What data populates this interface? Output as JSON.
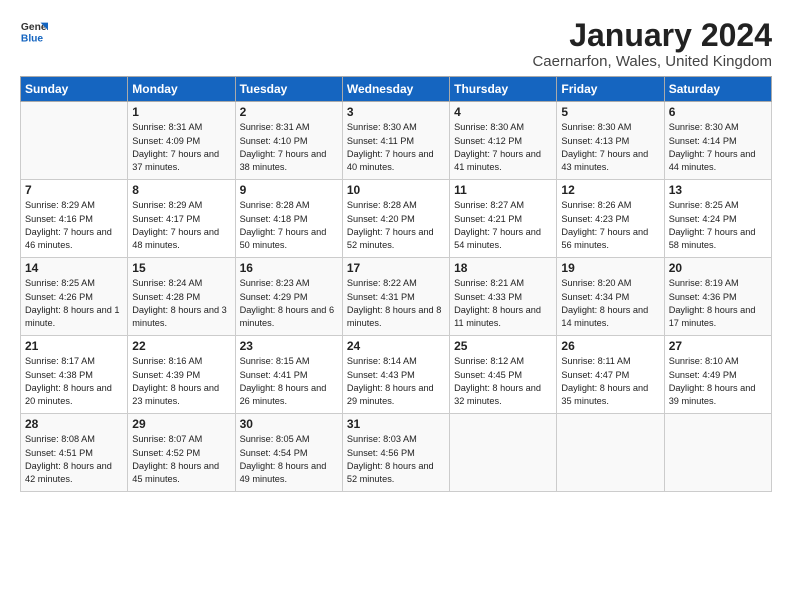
{
  "logo": {
    "line1": "General",
    "line2": "Blue"
  },
  "title": "January 2024",
  "subtitle": "Caernarfon, Wales, United Kingdom",
  "header_color": "#1565c0",
  "days_of_week": [
    "Sunday",
    "Monday",
    "Tuesday",
    "Wednesday",
    "Thursday",
    "Friday",
    "Saturday"
  ],
  "weeks": [
    [
      {
        "day": "",
        "sunrise": "",
        "sunset": "",
        "daylight": ""
      },
      {
        "day": "1",
        "sunrise": "Sunrise: 8:31 AM",
        "sunset": "Sunset: 4:09 PM",
        "daylight": "Daylight: 7 hours and 37 minutes."
      },
      {
        "day": "2",
        "sunrise": "Sunrise: 8:31 AM",
        "sunset": "Sunset: 4:10 PM",
        "daylight": "Daylight: 7 hours and 38 minutes."
      },
      {
        "day": "3",
        "sunrise": "Sunrise: 8:30 AM",
        "sunset": "Sunset: 4:11 PM",
        "daylight": "Daylight: 7 hours and 40 minutes."
      },
      {
        "day": "4",
        "sunrise": "Sunrise: 8:30 AM",
        "sunset": "Sunset: 4:12 PM",
        "daylight": "Daylight: 7 hours and 41 minutes."
      },
      {
        "day": "5",
        "sunrise": "Sunrise: 8:30 AM",
        "sunset": "Sunset: 4:13 PM",
        "daylight": "Daylight: 7 hours and 43 minutes."
      },
      {
        "day": "6",
        "sunrise": "Sunrise: 8:30 AM",
        "sunset": "Sunset: 4:14 PM",
        "daylight": "Daylight: 7 hours and 44 minutes."
      }
    ],
    [
      {
        "day": "7",
        "sunrise": "Sunrise: 8:29 AM",
        "sunset": "Sunset: 4:16 PM",
        "daylight": "Daylight: 7 hours and 46 minutes."
      },
      {
        "day": "8",
        "sunrise": "Sunrise: 8:29 AM",
        "sunset": "Sunset: 4:17 PM",
        "daylight": "Daylight: 7 hours and 48 minutes."
      },
      {
        "day": "9",
        "sunrise": "Sunrise: 8:28 AM",
        "sunset": "Sunset: 4:18 PM",
        "daylight": "Daylight: 7 hours and 50 minutes."
      },
      {
        "day": "10",
        "sunrise": "Sunrise: 8:28 AM",
        "sunset": "Sunset: 4:20 PM",
        "daylight": "Daylight: 7 hours and 52 minutes."
      },
      {
        "day": "11",
        "sunrise": "Sunrise: 8:27 AM",
        "sunset": "Sunset: 4:21 PM",
        "daylight": "Daylight: 7 hours and 54 minutes."
      },
      {
        "day": "12",
        "sunrise": "Sunrise: 8:26 AM",
        "sunset": "Sunset: 4:23 PM",
        "daylight": "Daylight: 7 hours and 56 minutes."
      },
      {
        "day": "13",
        "sunrise": "Sunrise: 8:25 AM",
        "sunset": "Sunset: 4:24 PM",
        "daylight": "Daylight: 7 hours and 58 minutes."
      }
    ],
    [
      {
        "day": "14",
        "sunrise": "Sunrise: 8:25 AM",
        "sunset": "Sunset: 4:26 PM",
        "daylight": "Daylight: 8 hours and 1 minute."
      },
      {
        "day": "15",
        "sunrise": "Sunrise: 8:24 AM",
        "sunset": "Sunset: 4:28 PM",
        "daylight": "Daylight: 8 hours and 3 minutes."
      },
      {
        "day": "16",
        "sunrise": "Sunrise: 8:23 AM",
        "sunset": "Sunset: 4:29 PM",
        "daylight": "Daylight: 8 hours and 6 minutes."
      },
      {
        "day": "17",
        "sunrise": "Sunrise: 8:22 AM",
        "sunset": "Sunset: 4:31 PM",
        "daylight": "Daylight: 8 hours and 8 minutes."
      },
      {
        "day": "18",
        "sunrise": "Sunrise: 8:21 AM",
        "sunset": "Sunset: 4:33 PM",
        "daylight": "Daylight: 8 hours and 11 minutes."
      },
      {
        "day": "19",
        "sunrise": "Sunrise: 8:20 AM",
        "sunset": "Sunset: 4:34 PM",
        "daylight": "Daylight: 8 hours and 14 minutes."
      },
      {
        "day": "20",
        "sunrise": "Sunrise: 8:19 AM",
        "sunset": "Sunset: 4:36 PM",
        "daylight": "Daylight: 8 hours and 17 minutes."
      }
    ],
    [
      {
        "day": "21",
        "sunrise": "Sunrise: 8:17 AM",
        "sunset": "Sunset: 4:38 PM",
        "daylight": "Daylight: 8 hours and 20 minutes."
      },
      {
        "day": "22",
        "sunrise": "Sunrise: 8:16 AM",
        "sunset": "Sunset: 4:39 PM",
        "daylight": "Daylight: 8 hours and 23 minutes."
      },
      {
        "day": "23",
        "sunrise": "Sunrise: 8:15 AM",
        "sunset": "Sunset: 4:41 PM",
        "daylight": "Daylight: 8 hours and 26 minutes."
      },
      {
        "day": "24",
        "sunrise": "Sunrise: 8:14 AM",
        "sunset": "Sunset: 4:43 PM",
        "daylight": "Daylight: 8 hours and 29 minutes."
      },
      {
        "day": "25",
        "sunrise": "Sunrise: 8:12 AM",
        "sunset": "Sunset: 4:45 PM",
        "daylight": "Daylight: 8 hours and 32 minutes."
      },
      {
        "day": "26",
        "sunrise": "Sunrise: 8:11 AM",
        "sunset": "Sunset: 4:47 PM",
        "daylight": "Daylight: 8 hours and 35 minutes."
      },
      {
        "day": "27",
        "sunrise": "Sunrise: 8:10 AM",
        "sunset": "Sunset: 4:49 PM",
        "daylight": "Daylight: 8 hours and 39 minutes."
      }
    ],
    [
      {
        "day": "28",
        "sunrise": "Sunrise: 8:08 AM",
        "sunset": "Sunset: 4:51 PM",
        "daylight": "Daylight: 8 hours and 42 minutes."
      },
      {
        "day": "29",
        "sunrise": "Sunrise: 8:07 AM",
        "sunset": "Sunset: 4:52 PM",
        "daylight": "Daylight: 8 hours and 45 minutes."
      },
      {
        "day": "30",
        "sunrise": "Sunrise: 8:05 AM",
        "sunset": "Sunset: 4:54 PM",
        "daylight": "Daylight: 8 hours and 49 minutes."
      },
      {
        "day": "31",
        "sunrise": "Sunrise: 8:03 AM",
        "sunset": "Sunset: 4:56 PM",
        "daylight": "Daylight: 8 hours and 52 minutes."
      },
      {
        "day": "",
        "sunrise": "",
        "sunset": "",
        "daylight": ""
      },
      {
        "day": "",
        "sunrise": "",
        "sunset": "",
        "daylight": ""
      },
      {
        "day": "",
        "sunrise": "",
        "sunset": "",
        "daylight": ""
      }
    ]
  ]
}
